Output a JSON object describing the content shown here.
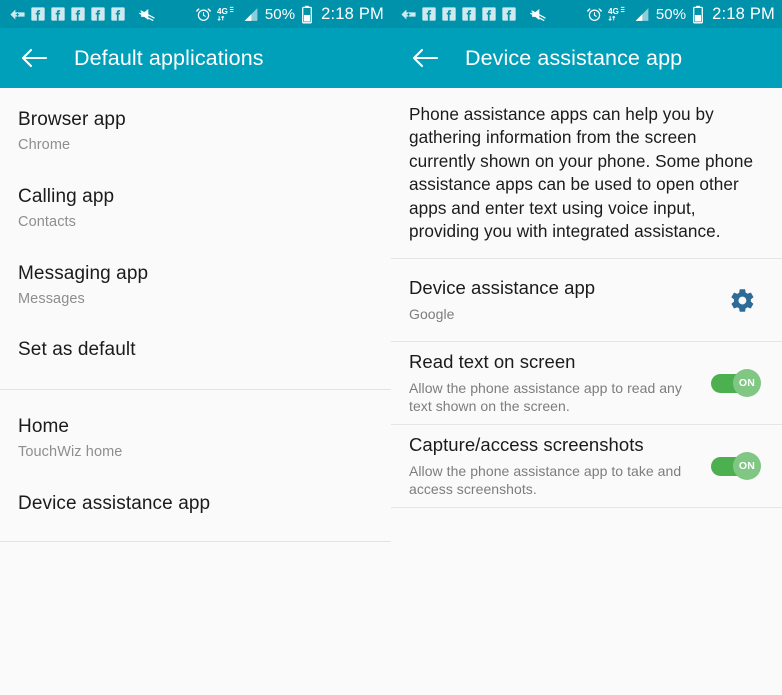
{
  "status_bar": {
    "icons": [
      "download-badge-icon",
      "facebook-icon",
      "facebook-icon",
      "facebook-icon",
      "facebook-icon",
      "facebook-icon",
      "mute-icon",
      "alarm-icon",
      "network-4g-icon",
      "signal-bars-icon"
    ],
    "battery_percent": "50%",
    "clock": "2:18 PM",
    "background_color": "#0092AB"
  },
  "left_panel": {
    "appbar": {
      "back_label": "back-arrow",
      "title": "Default applications",
      "background_color": "#00A0BA"
    },
    "items": [
      {
        "title": "Browser app",
        "subtitle": "Chrome"
      },
      {
        "title": "Calling app",
        "subtitle": "Contacts"
      },
      {
        "title": "Messaging app",
        "subtitle": "Messages"
      },
      {
        "title": "Set as default",
        "subtitle": ""
      },
      {
        "title": "Home",
        "subtitle": "TouchWiz home"
      },
      {
        "title": "Device assistance app",
        "subtitle": ""
      }
    ]
  },
  "right_panel": {
    "appbar": {
      "back_label": "back-arrow",
      "title": "Device assistance app",
      "background_color": "#00A0BA"
    },
    "description": "Phone assistance apps can help you by gathering information from the screen currently shown on your phone. Some phone assistance apps can be used to open other apps and enter text using voice input, providing you with integrated assistance.",
    "rows": [
      {
        "title": "Device assistance app",
        "subtitle": "Google",
        "control": "gear",
        "gear_color": "#2E6B96"
      },
      {
        "title": "Read text on screen",
        "subtitle": "Allow the phone assistance app to read any text shown on the screen.",
        "control": "toggle",
        "toggle_state": "ON",
        "toggle_track_color": "#4CAF50",
        "toggle_knob_color": "#81C784"
      },
      {
        "title": "Capture/access screenshots",
        "subtitle": "Allow the phone assistance app to take and access screenshots.",
        "control": "toggle",
        "toggle_state": "ON",
        "toggle_track_color": "#4CAF50",
        "toggle_knob_color": "#81C784"
      }
    ]
  }
}
